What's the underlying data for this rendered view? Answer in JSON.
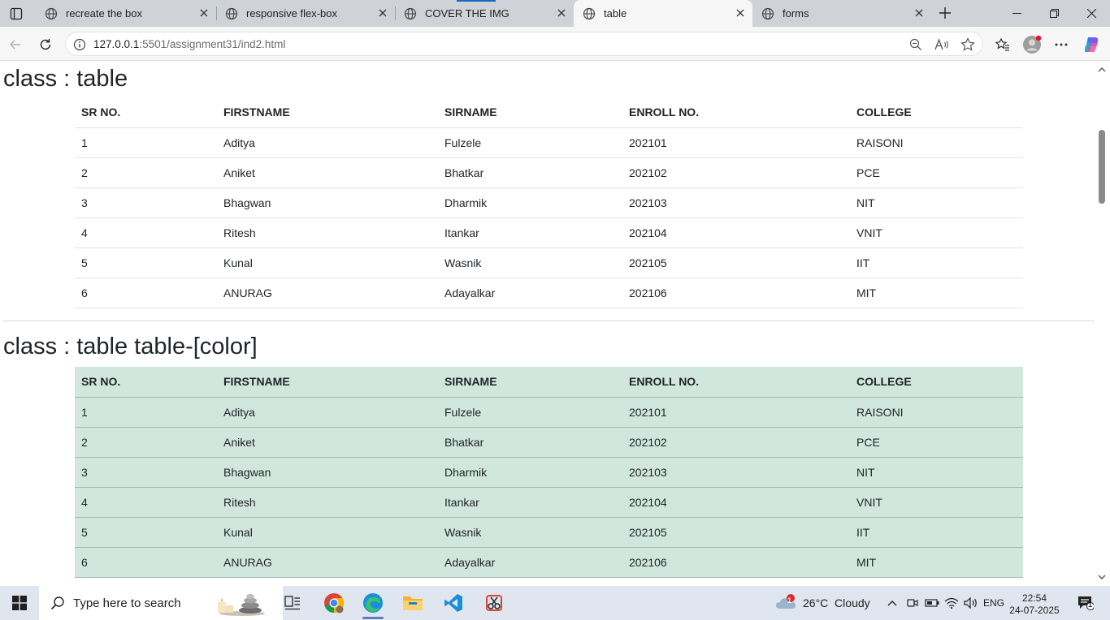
{
  "browser": {
    "tabs": [
      {
        "label": "recreate the box",
        "active": false
      },
      {
        "label": "responsive flex-box",
        "active": false
      },
      {
        "label": "COVER THE IMG",
        "active": false
      },
      {
        "label": "table",
        "active": true
      },
      {
        "label": "forms",
        "active": false
      }
    ],
    "url_host": "127.0.0.1",
    "url_rest": ":5501/assignment31/ind2.html"
  },
  "page": {
    "section1_title": "class : table",
    "section2_title": "class : table table-[color]",
    "table_color": "#d1e7dd",
    "columns": [
      "SR NO.",
      "FIRSTNAME",
      "SIRNAME",
      "ENROLL NO.",
      "COLLEGE"
    ],
    "rows": [
      [
        "1",
        "Aditya",
        "Fulzele",
        "202101",
        "RAISONI"
      ],
      [
        "2",
        "Aniket",
        "Bhatkar",
        "202102",
        "PCE"
      ],
      [
        "3",
        "Bhagwan",
        "Dharmik",
        "202103",
        "NIT"
      ],
      [
        "4",
        "Ritesh",
        "Itankar",
        "202104",
        "VNIT"
      ],
      [
        "5",
        "Kunal",
        "Wasnik",
        "202105",
        "IIT"
      ],
      [
        "6",
        "ANURAG",
        "Adayalkar",
        "202106",
        "MIT"
      ]
    ]
  },
  "taskbar": {
    "search_placeholder": "Type here to search",
    "weather": "26°C  Cloudy",
    "weather_badge": "1",
    "language": "ENG",
    "time": "22:54",
    "date": "24-07-2025",
    "notification_count": "1"
  }
}
